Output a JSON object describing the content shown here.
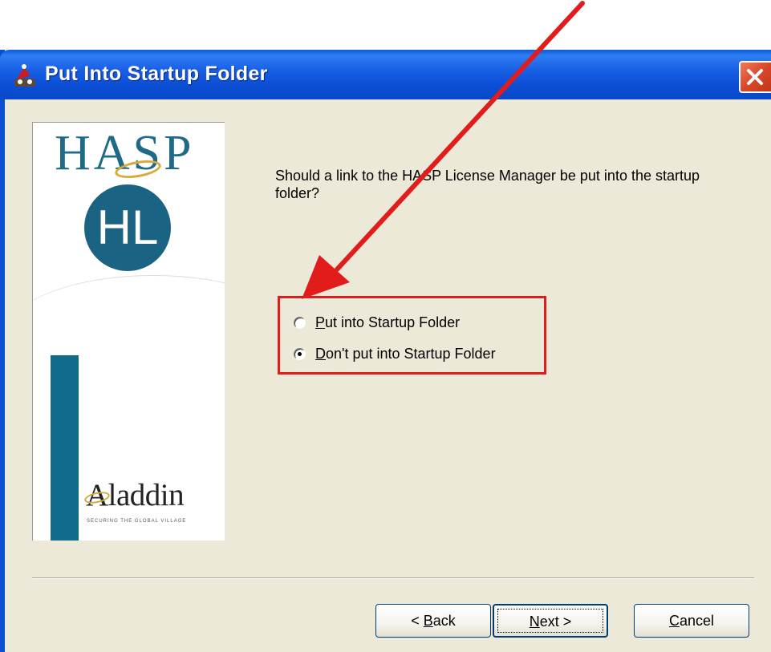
{
  "window": {
    "title": "Put Into Startup Folder",
    "close_icon": "close-icon"
  },
  "logo": {
    "brand": "HASP",
    "product": "HL",
    "company": "Aladdin",
    "tagline": "SECURING THE GLOBAL VILLAGE"
  },
  "content": {
    "question": "Should a link to the HASP License Manager be put into the startup folder?",
    "options": [
      {
        "label_first": "P",
        "label_rest": "ut into Startup Folder",
        "checked": false
      },
      {
        "label_first": "D",
        "label_rest": "on't put into Startup Folder",
        "checked": true
      }
    ]
  },
  "buttons": {
    "back_prefix": "< ",
    "back_first": "B",
    "back_rest": "ack",
    "next_first": "N",
    "next_rest": "ext >",
    "cancel_first": "C",
    "cancel_rest": "ancel"
  },
  "colors": {
    "title_bar": "#0b4fd6",
    "highlight": "#e21b1b",
    "accent_teal": "#1a6382"
  }
}
